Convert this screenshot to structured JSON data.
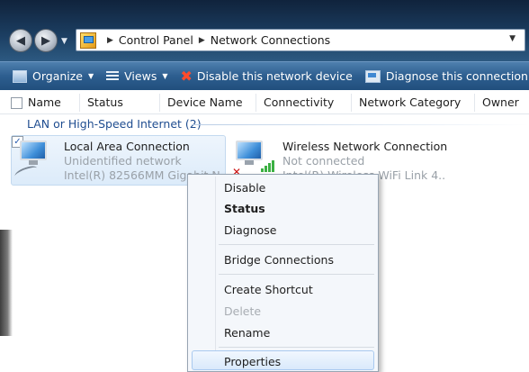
{
  "breadcrumb": {
    "items": [
      "Control Panel",
      "Network Connections"
    ],
    "separator": "▶"
  },
  "toolbar": {
    "organize": "Organize",
    "views": "Views",
    "disable": "Disable this network device",
    "diagnose": "Diagnose this connection"
  },
  "columns": [
    "Name",
    "Status",
    "Device Name",
    "Connectivity",
    "Network Category",
    "Owner"
  ],
  "group": {
    "label": "LAN or High-Speed Internet (2)"
  },
  "items": [
    {
      "name": "Local Area Connection",
      "status": "Unidentified network",
      "device": "Intel(R) 82566MM Gigabit N...",
      "selected": true
    },
    {
      "name": "Wireless Network Connection",
      "status": "Not connected",
      "device": "Intel(R) Wireless WiFi Link 4...",
      "selected": false
    }
  ],
  "context_menu": {
    "items": [
      {
        "label": "Disable"
      },
      {
        "label": "Status",
        "bold": true
      },
      {
        "label": "Diagnose"
      },
      {
        "label": "Bridge Connections"
      },
      {
        "label": "Create Shortcut"
      },
      {
        "label": "Delete",
        "disabled": true
      },
      {
        "label": "Rename"
      },
      {
        "label": "Properties",
        "highlighted": true
      }
    ]
  },
  "icons": {
    "back": "back-arrow-icon",
    "forward": "forward-arrow-icon",
    "control_panel": "control-panel-icon",
    "organize": "organize-icon",
    "views": "views-icon",
    "disable": "red-x-icon",
    "diagnose": "diagnose-icon",
    "lan": "network-adapter-icon",
    "wireless": "wireless-adapter-icon"
  },
  "colors": {
    "command_bar": "#2d5e8f",
    "group_text": "#1f4d90",
    "disable_x": "#ff4b2b",
    "menu_highlight": "#d9e9fb"
  }
}
